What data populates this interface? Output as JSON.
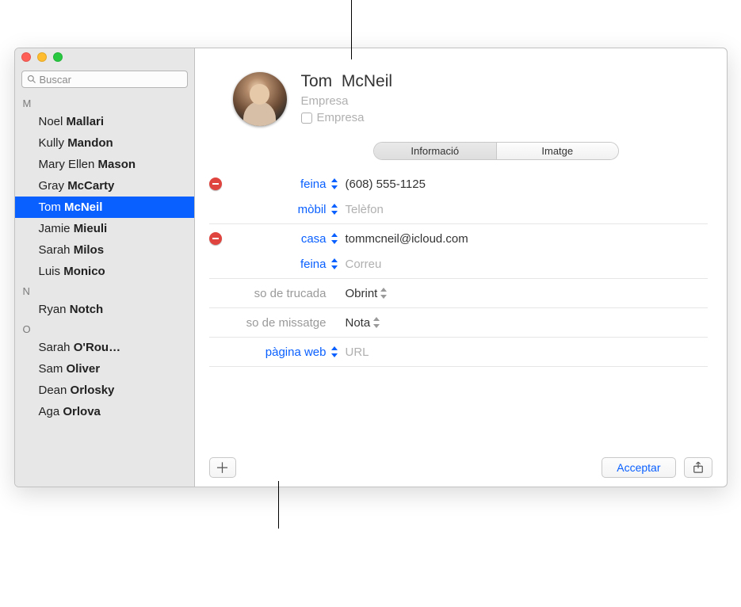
{
  "search": {
    "placeholder": "Buscar"
  },
  "sections": {
    "M": "M",
    "N": "N",
    "O": "O"
  },
  "contacts": {
    "m0": {
      "first": "Noel",
      "last": "Mallari"
    },
    "m1": {
      "first": "Kully",
      "last": "Mandon"
    },
    "m2": {
      "first": "Mary Ellen",
      "last": "Mason"
    },
    "m3": {
      "first": "Gray",
      "last": "McCarty"
    },
    "m4": {
      "first": "Tom",
      "last": "McNeil"
    },
    "m5": {
      "first": "Jamie",
      "last": "Mieuli"
    },
    "m6": {
      "first": "Sarah",
      "last": "Milos"
    },
    "m7": {
      "first": "Luis",
      "last": "Monico"
    },
    "n0": {
      "first": "Ryan",
      "last": "Notch"
    },
    "o0": {
      "first": "Sarah",
      "last": "O'Rou…"
    },
    "o1": {
      "first": "Sam",
      "last": "Oliver"
    },
    "o2": {
      "first": "Dean",
      "last": "Orlosky"
    },
    "o3": {
      "first": "Aga",
      "last": "Orlova"
    }
  },
  "detail": {
    "first_name": "Tom",
    "last_name": "McNeil",
    "company_placeholder": "Empresa",
    "company_checkbox_label": "Empresa",
    "tabs": {
      "info": "Informació",
      "image": "Imatge"
    },
    "phone_work_label": "feina",
    "phone_work_value": "(608) 555-1125",
    "phone_mobile_label": "mòbil",
    "phone_mobile_placeholder": "Telèfon",
    "email_home_label": "casa",
    "email_home_value": "tommcneil@icloud.com",
    "email_work_label": "feina",
    "email_work_placeholder": "Correu",
    "ringtone_label": "so de trucada",
    "ringtone_value": "Obrint",
    "texttone_label": "so de missatge",
    "texttone_value": "Nota",
    "url_label": "pàgina web",
    "url_placeholder": "URL",
    "accept_button": "Acceptar"
  }
}
